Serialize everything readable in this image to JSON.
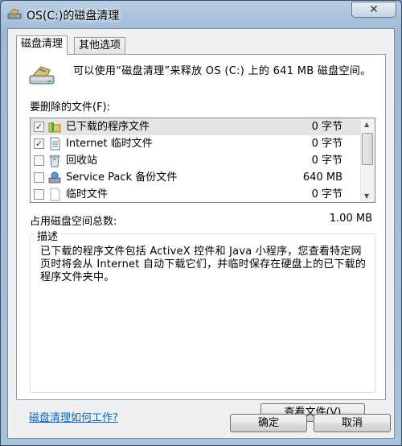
{
  "window": {
    "title": "OS(C:)的磁盘清理",
    "close_symbol": "✕"
  },
  "tabs": [
    {
      "label": "磁盘清理",
      "active": true
    },
    {
      "label": "其他选项",
      "active": false
    }
  ],
  "intro": "可以使用“磁盘清理”来释放 OS (C:) 上的 641 MB 磁盘空间。",
  "files_label": "要删除的文件(F):",
  "files": [
    {
      "name": "已下载的程序文件",
      "size": "0 字节",
      "checked": true,
      "icon": "folder-icon"
    },
    {
      "name": "Internet 临时文件",
      "size": "0 字节",
      "checked": true,
      "icon": "document-icon"
    },
    {
      "name": "回收站",
      "size": "0 字节",
      "checked": false,
      "icon": "recycle-bin-icon"
    },
    {
      "name": "Service Pack 备份文件",
      "size": "640 MB",
      "checked": false,
      "icon": "setup-icon"
    },
    {
      "name": "临时文件",
      "size": "0 字节",
      "checked": false,
      "icon": "blank-file-icon"
    }
  ],
  "total": {
    "label": "占用磁盘空间总数:",
    "value": "1.00 MB"
  },
  "description": {
    "title": "描述",
    "text": "已下载的程序文件包括 ActiveX 控件和 Java 小程序，您查看特定网页时将会从 Internet 自动下载它们，并临时保存在硬盘上的已下载的程序文件夹中。",
    "view_files_label": "查看文件(V)"
  },
  "help_link": "磁盘清理如何工作?",
  "buttons": {
    "ok": "确定",
    "cancel": "取消"
  },
  "check_mark": "✓"
}
